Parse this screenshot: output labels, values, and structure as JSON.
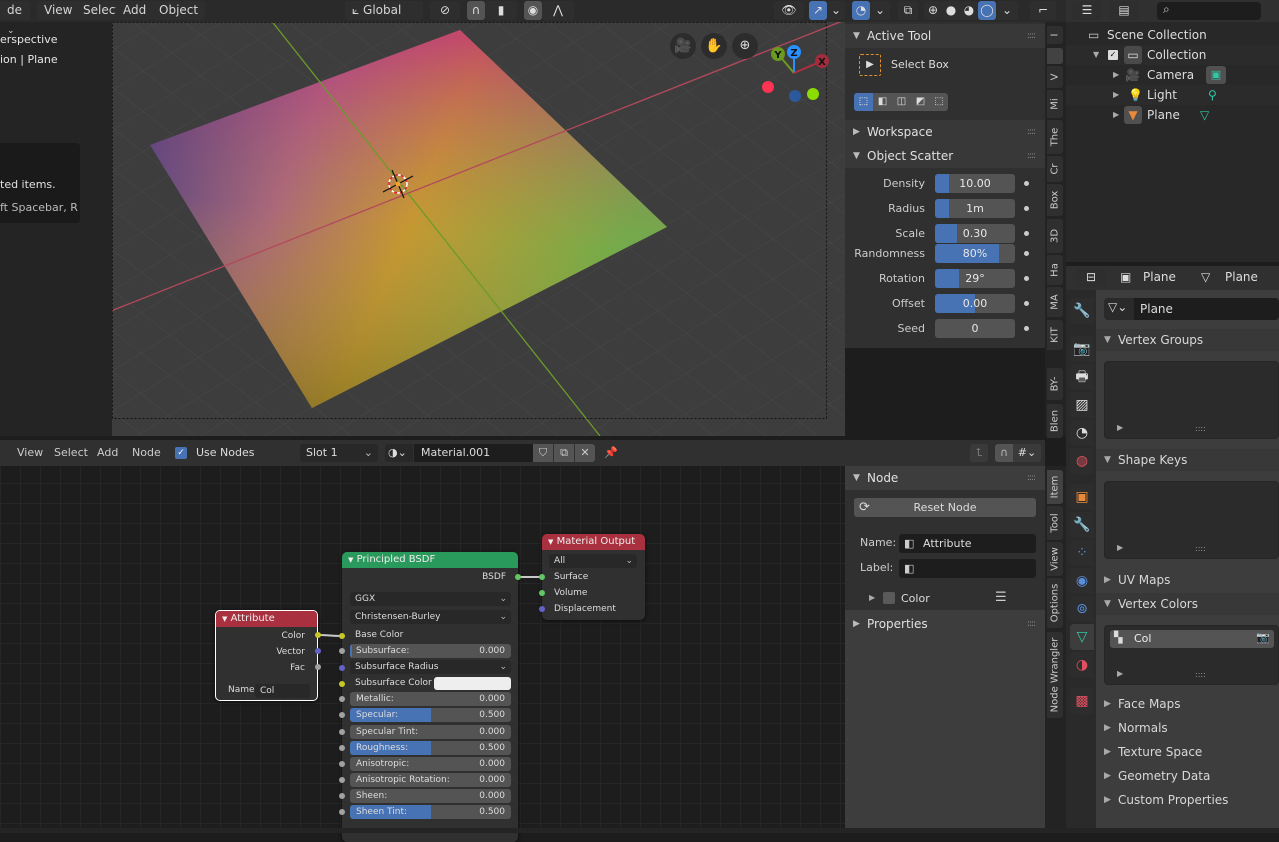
{
  "viewport": {
    "header": {
      "mode_label": "de",
      "menus": [
        "View",
        "Select",
        "Add",
        "Object"
      ],
      "orientation": "Global",
      "icons": [
        "transform-orientation-icon",
        "pivot-icon",
        "snap-icon",
        "snap-target-icon",
        "proportional-edit-icon",
        "falloff-icon",
        "visibility-icon",
        "gizmo-icon",
        "overlay-icon",
        "xray-icon",
        "shading-wireframe-icon",
        "shading-solid-icon",
        "shading-material-icon",
        "shading-rendered-icon",
        "editor-type-icon"
      ]
    },
    "info": {
      "view_name": "erspective",
      "collection_path": "ion | Plane"
    },
    "tooltip": {
      "line1": "ted items.",
      "line2": "ft Spacebar, R"
    },
    "gizmo": {
      "axes": [
        "X",
        "Y",
        "Z"
      ],
      "colors": {
        "x": "#ff3352",
        "y": "#8bdc00",
        "z": "#2890ff"
      }
    }
  },
  "sidebar_3d": {
    "active_tool": {
      "title": "Active Tool",
      "tool_name": "Select Box"
    },
    "workspace": "Workspace",
    "object_scatter": {
      "title": "Object Scatter",
      "props": [
        {
          "label": "Density",
          "value": "10.00",
          "fill": 0.18
        },
        {
          "label": "Radius",
          "value": "1m",
          "fill": 0.18
        },
        {
          "label": "Scale",
          "value": "0.30",
          "fill": 0.28
        },
        {
          "label": "Randomness",
          "value": "80%",
          "fill": 0.8
        },
        {
          "label": "Rotation",
          "value": "29°",
          "fill": 0.3
        },
        {
          "label": "Offset",
          "value": "0.00",
          "fill": 0.5
        },
        {
          "label": "Seed",
          "value": "0",
          "fill": 0
        }
      ]
    },
    "tabs": [
      "I",
      "",
      "V",
      "Mi",
      "The",
      "Cr",
      "Box",
      "3D",
      "Ha",
      "MA",
      "KIT",
      "BY-",
      "Blen"
    ]
  },
  "outliner": {
    "search_placeholder": "",
    "items": [
      {
        "label": "Scene Collection",
        "type": "scene-collection"
      },
      {
        "label": "Collection",
        "type": "collection"
      },
      {
        "label": "Camera",
        "type": "camera"
      },
      {
        "label": "Light",
        "type": "light"
      },
      {
        "label": "Plane",
        "type": "mesh"
      }
    ]
  },
  "properties": {
    "breadcrumb": [
      "Plane",
      "Plane"
    ],
    "data_name": "Plane",
    "sections": {
      "vertex_groups": "Vertex Groups",
      "shape_keys": "Shape Keys",
      "uv_maps": "UV Maps",
      "vertex_colors": "Vertex Colors",
      "face_maps": "Face Maps",
      "normals": "Normals",
      "texture_space": "Texture Space",
      "geometry_data": "Geometry Data",
      "custom_properties": "Custom Properties"
    },
    "vertex_color_item": "Col"
  },
  "node_editor": {
    "header": {
      "menus": [
        "View",
        "Select",
        "Add",
        "Node"
      ],
      "use_nodes_label": "Use Nodes",
      "use_nodes_checked": true,
      "slot": "Slot 1",
      "material": "Material.001"
    },
    "nodes": {
      "attribute": {
        "title": "Attribute",
        "outputs": [
          "Color",
          "Vector",
          "Fac"
        ],
        "name_label": "Name:",
        "name_value": "Col"
      },
      "principled": {
        "title": "Principled BSDF",
        "output": "BSDF",
        "distribution": "GGX",
        "subsurface_method": "Christensen-Burley",
        "base_color": "Base Color",
        "subsurface_radius": "Subsurface Radius",
        "subsurface_color": "Subsurface Color",
        "fields": [
          {
            "label": "Subsurface:",
            "value": "0.000",
            "fill": 0
          },
          {
            "label": "Metallic:",
            "value": "0.000",
            "fill": 0
          },
          {
            "label": "Specular:",
            "value": "0.500",
            "fill": 0.5
          },
          {
            "label": "Specular Tint:",
            "value": "0.000",
            "fill": 0
          },
          {
            "label": "Roughness:",
            "value": "0.500",
            "fill": 0.5
          },
          {
            "label": "Anisotropic:",
            "value": "0.000",
            "fill": 0
          },
          {
            "label": "Anisotropic Rotation:",
            "value": "0.000",
            "fill": 0
          },
          {
            "label": "Sheen:",
            "value": "0.000",
            "fill": 0
          },
          {
            "label": "Sheen Tint:",
            "value": "0.500",
            "fill": 0.5
          }
        ]
      },
      "output": {
        "title": "Material Output",
        "target": "All",
        "inputs": [
          "Surface",
          "Volume",
          "Displacement"
        ]
      }
    },
    "sidebar": {
      "node_title": "Node",
      "reset_label": "Reset Node",
      "name_label": "Name:",
      "name_value": "Attribute",
      "label_label": "Label:",
      "label_value": "",
      "color_label": "Color",
      "properties_title": "Properties",
      "tabs": [
        "Item",
        "Tool",
        "View",
        "Options",
        "Node Wrangler"
      ]
    }
  }
}
